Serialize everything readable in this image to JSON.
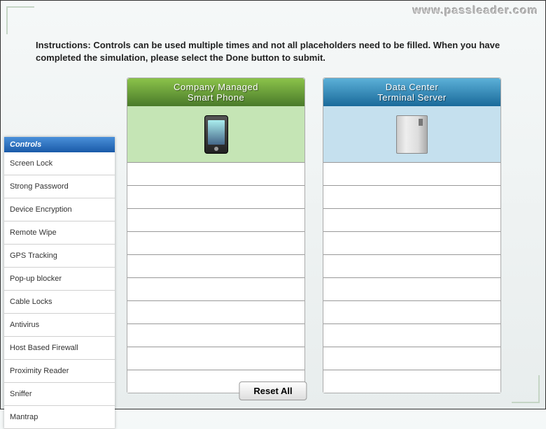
{
  "watermark": "www.passleader.com",
  "instructions": "Instructions: Controls can be used multiple times and not all placeholders need to be filled. When you have completed the simulation, please select the Done button to submit.",
  "panels": {
    "left": {
      "title1": "Company Managed",
      "title2": "Smart Phone"
    },
    "right": {
      "title1": "Data Center",
      "title2": "Terminal Server"
    }
  },
  "controls": {
    "header": "Controls",
    "items": [
      "Screen Lock",
      "Strong Password",
      "Device Encryption",
      "Remote Wipe",
      "GPS Tracking",
      "Pop-up blocker",
      "Cable Locks",
      "Antivirus",
      "Host Based Firewall",
      "Proximity Reader",
      "Sniffer",
      "Mantrap"
    ]
  },
  "reset_label": "Reset All"
}
